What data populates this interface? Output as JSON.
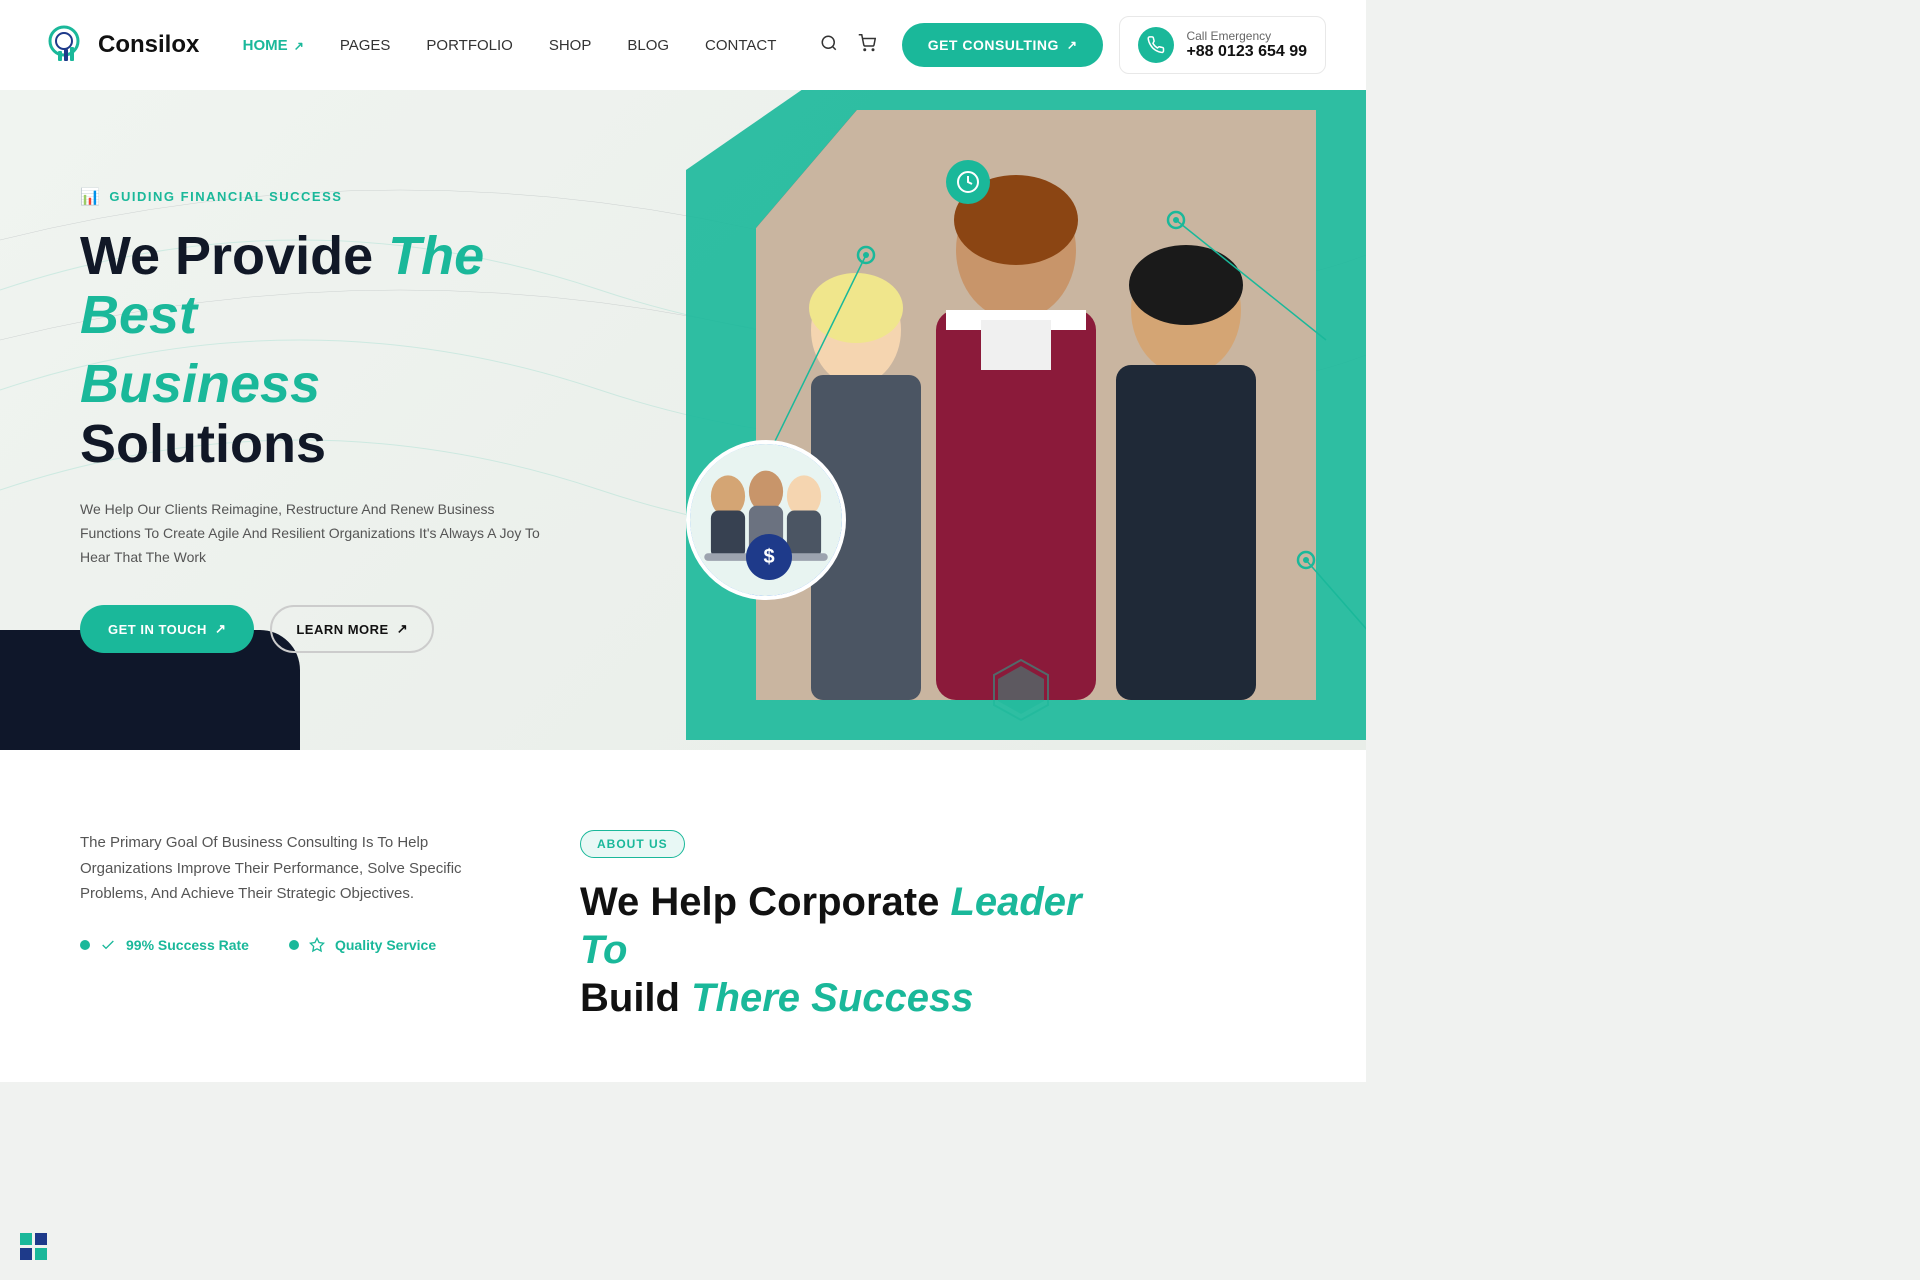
{
  "brand": {
    "name": "Consilox"
  },
  "nav": {
    "items": [
      {
        "label": "HOME",
        "active": true,
        "has_arrow": true
      },
      {
        "label": "PAGES",
        "active": false,
        "has_arrow": false
      },
      {
        "label": "PORTFOLIO",
        "active": false,
        "has_arrow": false
      },
      {
        "label": "SHOP",
        "active": false,
        "has_arrow": false
      },
      {
        "label": "BLOG",
        "active": false,
        "has_arrow": false
      },
      {
        "label": "CONTACT",
        "active": false,
        "has_arrow": false
      }
    ]
  },
  "header": {
    "consulting_btn": "GET CONSULTING",
    "emergency_label": "Call Emergency",
    "emergency_number": "+88 0123 654 99"
  },
  "hero": {
    "subtitle": "GUIDING FINANCIAL SUCCESS",
    "title_part1": "We Provide ",
    "title_italic": "The Best",
    "title_line2_teal": "Business",
    "title_line2_dark": " Solutions",
    "description": "We Help Our Clients Reimagine, Restructure And Renew Business Functions To Create Agile And Resilient Organizations It's Always A Joy To Hear That The Work",
    "btn_touch": "GET IN TOUCH",
    "btn_learn": "LEARN MORE"
  },
  "about": {
    "badge": "ABOUT US",
    "description": "The Primary Goal Of Business Consulting Is To Help Organizations Improve Their Performance, Solve Specific Problems, And Achieve Their Strategic Objectives.",
    "stat1": "99% Success Rate",
    "stat2": "Quality Service",
    "title_part1": "We Help Corporate ",
    "title_italic1": "Leader To",
    "title_part2": "Build ",
    "title_italic2": "There Success"
  },
  "colors": {
    "teal": "#1ab89a",
    "dark_navy": "#0f172a",
    "mid_navy": "#1e3a8a"
  }
}
